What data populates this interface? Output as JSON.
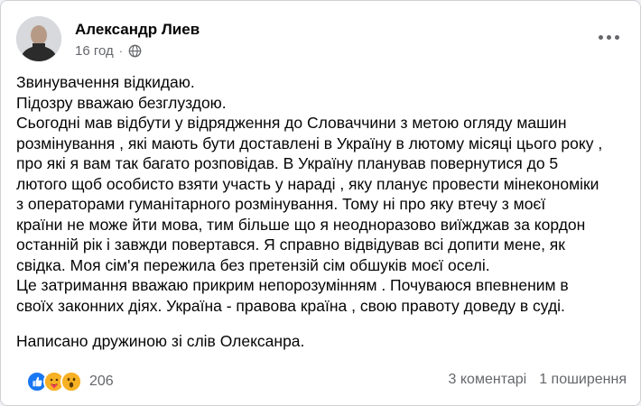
{
  "post": {
    "author": "Александр Лиев",
    "time": "16 год",
    "separator": "·",
    "audience_icon": "globe-icon",
    "lines": [
      "Звинувачення відкидаю.",
      "Підозру вважаю безглуздою.",
      "Сьогодні мав відбути у  відрядження до Словаччини з метою огляду машин",
      "розмінування , які мають бути доставлені в Україну в лютому місяці цього року ,",
      "про які я вам так багато розповідав. В Україну планував повернутися до  5",
      "лютого щоб особисто взяти участь у нараді , яку планує провести мінекономіки",
      "з операторами гуманітарного розмінування.  Тому ні про яку втечу з моєї",
      "країни не може йти мова, тим більше що я неодноразово виїжджав за кордон",
      "останній рік і завжди повертався. Я справно відвідував всі допити мене, як",
      "свідка. Моя сім'я пережила без претензій сім  обшуків моєї оселі.",
      "Це затримання вважаю прикрим непорозумінням . Почуваюся впевненим в",
      "своїх законних діях. Україна - правова країна , свою правоту доведу в суді."
    ],
    "signature": "Написано дружиною зі слів Олексанра."
  },
  "reactions": {
    "icons": [
      "like-icon",
      "care-icon",
      "wow-icon"
    ],
    "count": "206"
  },
  "stats": {
    "comments": "3 коментарі",
    "shares": "1 поширення"
  },
  "colors": {
    "text": "#050505",
    "secondary": "#65676b",
    "like_blue": "#1877f2",
    "emoji_yellow": "#f7b125"
  }
}
